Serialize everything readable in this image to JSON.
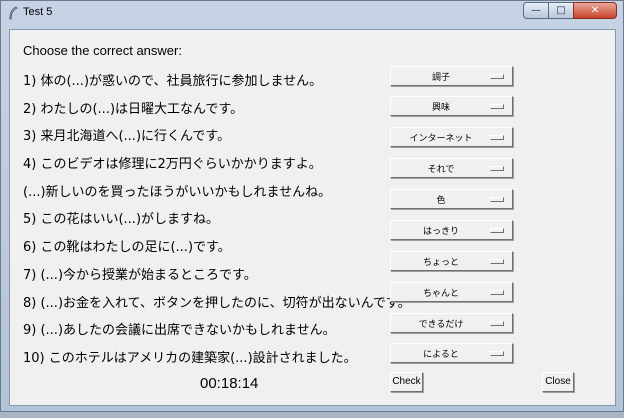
{
  "window": {
    "title": "Test 5",
    "controls": {
      "minimize": "—",
      "maximize": "□",
      "close": "✕"
    }
  },
  "heading": "Choose the correct answer:",
  "questions": [
    {
      "text": "1) 体の(...)が惑いので、社員旅行に参加しません。",
      "answer": "調子"
    },
    {
      "text": "2) わたしの(...)は日曜大工なんです。",
      "answer": "興味"
    },
    {
      "text": "3) 来月北海道へ(...)に行くんです。",
      "answer": "インターネット"
    },
    {
      "text": "4) このビデオは修理に2万円ぐらいかかりますよ。",
      "answer": "それで"
    },
    {
      "text": "(...)新しいのを買ったほうがいいかもしれませんね。",
      "answer": "色"
    },
    {
      "text": "5) この花はいい(...)がしますね。",
      "answer": "はっきり"
    },
    {
      "text": "6) この靴はわたしの足に(...)です。",
      "answer": "ちょっと"
    },
    {
      "text": "7) (...)今から授業が始まるところです。",
      "answer": "ちゃんと"
    },
    {
      "text": "8) (...)お金を入れて、ボタンを押したのに、切符が出ないんです。",
      "answer": "できるだけ"
    },
    {
      "text": "9) (...)あしたの会議に出席できないかもしれません。",
      "answer": "によると"
    },
    {
      "text": "10) このホテルはアメリカの建築家(...)設計されました。",
      "answer": ""
    }
  ],
  "timer": "00:18:14",
  "buttons": {
    "check": "Check",
    "close": "Close"
  }
}
